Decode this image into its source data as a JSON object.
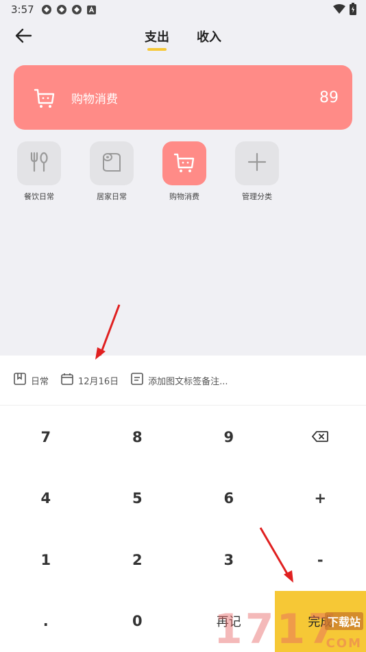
{
  "status_bar": {
    "time": "3:57",
    "left_icons": [
      "sync-icon",
      "sync-icon",
      "sync-icon",
      "font-icon"
    ],
    "right_icons": [
      "wifi-icon",
      "battery-icon"
    ]
  },
  "header": {
    "back_icon": "arrow-left-icon",
    "tabs": [
      {
        "label": "支出",
        "active": true
      },
      {
        "label": "收入",
        "active": false
      }
    ]
  },
  "hero": {
    "icon": "shopping-cart-icon",
    "name": "购物消费",
    "amount": "89",
    "color": "#ff8b87"
  },
  "categories": [
    {
      "label": "餐饮日常",
      "icon": "fork-spoon-icon",
      "active": false
    },
    {
      "label": "居家日常",
      "icon": "toilet-paper-icon",
      "active": false
    },
    {
      "label": "购物消费",
      "icon": "shopping-cart-icon",
      "active": true
    },
    {
      "label": "管理分类",
      "icon": "plus-icon",
      "active": false
    }
  ],
  "meta": {
    "book": "日常",
    "date": "12月16日",
    "note_placeholder": "添加图文标签备注..."
  },
  "keypad": {
    "rows": [
      [
        "7",
        "8",
        "9",
        "⌫"
      ],
      [
        "4",
        "5",
        "6",
        "+"
      ],
      [
        "1",
        "2",
        "3",
        "-"
      ],
      [
        ".",
        "0",
        "再记",
        "完成"
      ]
    ],
    "accent": "#f6c836"
  },
  "watermark": {
    "text": "1717",
    "suffix": "下载站",
    "domain": "COM"
  }
}
